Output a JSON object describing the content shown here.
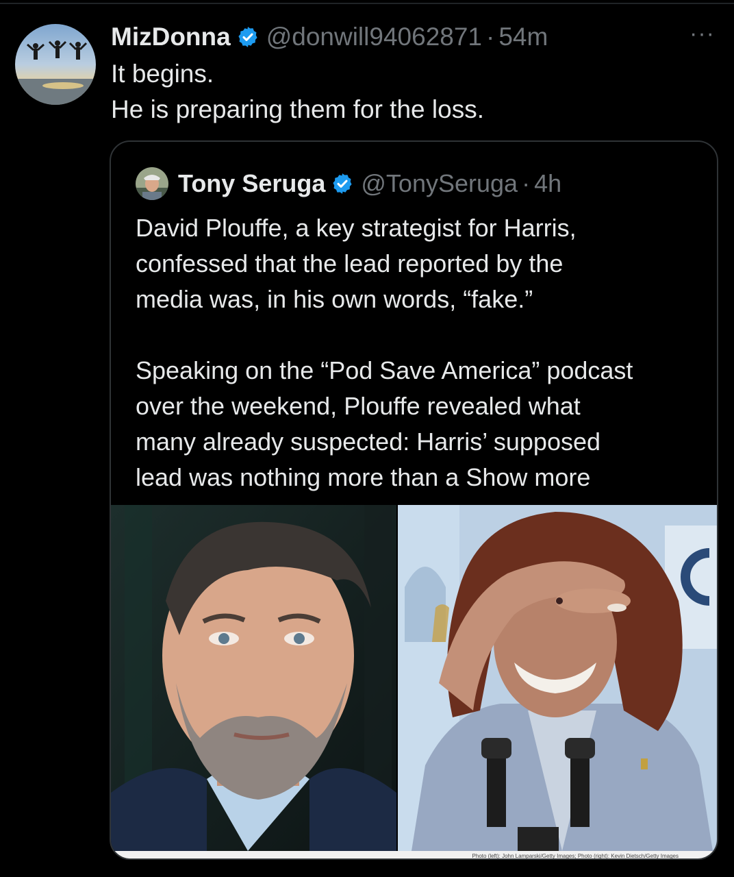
{
  "post": {
    "author_name": "MizDonna",
    "handle": "@donwill94062871",
    "separator": "·",
    "time": "54m",
    "more_label": "···",
    "lines": [
      "It begins.",
      "He is preparing them for the loss."
    ]
  },
  "quoted_post": {
    "author_name": "Tony Seruga",
    "handle": "@TonySeruga",
    "separator": "·",
    "time": "4h",
    "paragraph1": [
      "David Plouffe, a key strategist for Harris,",
      "confessed that the lead reported by the",
      "media was, in his own words, “fake.”"
    ],
    "paragraph2": [
      "Speaking on the “Pod Save America” podcast",
      "over the weekend, Plouffe revealed what",
      "many already suspected: Harris’ supposed"
    ],
    "last_line_text": "lead was nothing more than a ",
    "show_more": "Show more",
    "photo_credit": "Photo (left): John Lamparski/Getty Images; Photo (right): Kevin Dietsch/Getty Images"
  },
  "colors": {
    "background": "#000000",
    "text_primary": "#e7e9ea",
    "text_secondary": "#71767b",
    "verified": "#1d9bf0",
    "border": "#2f3336"
  },
  "icons": {
    "verified": "verified-badge-icon",
    "more": "more-options-icon"
  }
}
